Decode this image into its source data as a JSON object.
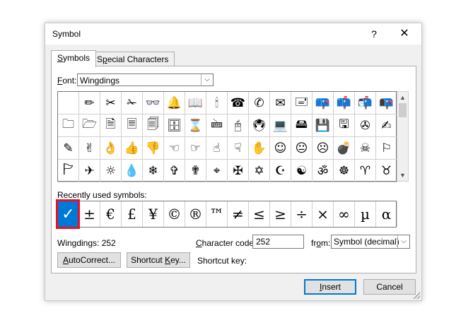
{
  "window": {
    "title": "Symbol",
    "help_label": "?",
    "close_label": "✕"
  },
  "tabs": [
    {
      "label": "Symbols",
      "access_key": "S",
      "active": true
    },
    {
      "label": "Special Characters",
      "access_key": "P",
      "active": false
    }
  ],
  "font": {
    "label_prefix": "F",
    "label_rest": "ont:",
    "value": "Wingdings"
  },
  "symbols_grid": [
    [
      "",
      "✏",
      "✂",
      "✁",
      "👓",
      "🔔",
      "📖",
      "🕯",
      "☎",
      "✆",
      "✉",
      "🖃",
      "📪",
      "📫",
      "📬",
      "📭"
    ],
    [
      "🗀",
      "🗁",
      "🗎",
      "🗏",
      "🗐",
      "🗄",
      "⌛",
      "🖮",
      "🖰",
      "🖲",
      "💻",
      "🖴",
      "💾",
      "🖫",
      "✇",
      "✍"
    ],
    [
      "✎",
      "✌",
      "👌",
      "👍",
      "👎",
      "☜",
      "☞",
      "☝",
      "☟",
      "✋",
      "☺",
      "😐",
      "☹",
      "💣",
      "☠",
      "⚐"
    ],
    [
      "🏱",
      "✈",
      "☼",
      "💧",
      "❄",
      "✞",
      "✟",
      "⌖",
      "✠",
      "✡",
      "☪",
      "☯",
      "ॐ",
      "☸",
      "♈",
      "♉"
    ]
  ],
  "recent": {
    "label": "Recently used symbols:",
    "symbols": [
      "✓",
      "±",
      "€",
      "£",
      "¥",
      "©",
      "®",
      "™",
      "≠",
      "≤",
      "≥",
      "÷",
      "×",
      "∞",
      "µ",
      "α"
    ],
    "selected_index": 0
  },
  "info": {
    "name_code": "Wingdings: 252",
    "char_code_label_prefix": "C",
    "char_code_label_rest": "haracter code:",
    "char_code_value": "252",
    "from_label_prefix": "fr",
    "from_label_key": "o",
    "from_label_rest": "m:",
    "from_value": "Symbol (decimal)"
  },
  "buttons": {
    "autocorrect_key": "A",
    "autocorrect_rest": "utoCorrect...",
    "shortcut_pre": "Shortcut ",
    "shortcut_key": "K",
    "shortcut_rest": "ey...",
    "shortcut_key_label": "Shortcut key:",
    "insert_key": "I",
    "insert_rest": "nsert",
    "cancel": "Cancel"
  }
}
